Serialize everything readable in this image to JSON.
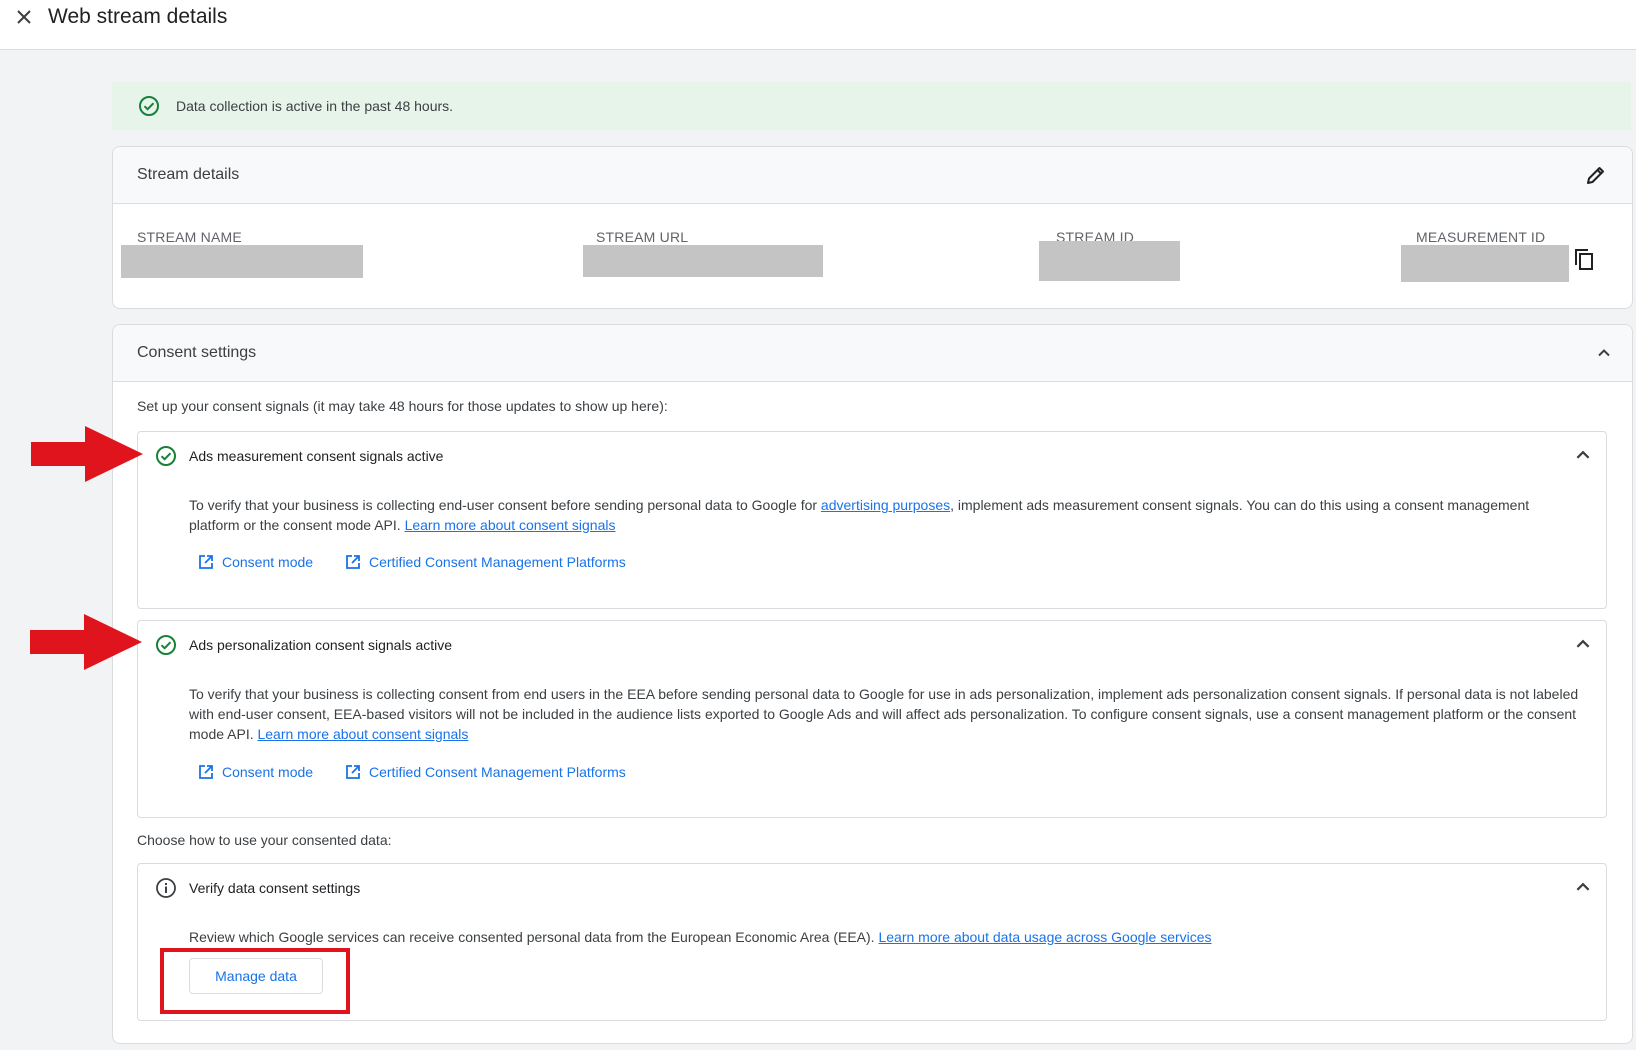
{
  "header": {
    "title": "Web stream details"
  },
  "banner": {
    "text": "Data collection is active in the past 48 hours."
  },
  "stream_details": {
    "title": "Stream details",
    "columns": [
      {
        "label": "STREAM NAME"
      },
      {
        "label": "STREAM URL"
      },
      {
        "label": "STREAM ID"
      },
      {
        "label": "MEASUREMENT ID"
      }
    ]
  },
  "consent": {
    "title": "Consent settings",
    "intro": "Set up your consent signals (it may take 48 hours for those updates to show up here):",
    "measurement": {
      "title": "Ads measurement consent signals active",
      "desc_1": "To verify that your business is collecting end-user consent before sending personal data to Google for ",
      "link_1": "advertising purposes",
      "desc_2": ", implement ads measurement consent signals. You can do this using a consent management platform or the consent mode API. ",
      "link_2": "Learn more about consent signals",
      "btn_1": "Consent mode",
      "btn_2": "Certified Consent Management Platforms"
    },
    "personalization": {
      "title": "Ads personalization consent signals active",
      "desc": "To verify that your business is collecting consent from end users in the EEA before sending personal data to Google for use in ads personalization, implement ads personalization consent signals. If personal data is not labeled with end-user consent, EEA-based visitors will not be included in the audience lists exported to Google Ads and will affect ads personalization. To configure consent signals, use a consent management platform or the consent mode API. ",
      "link": "Learn more about consent signals",
      "btn_1": "Consent mode",
      "btn_2": "Certified Consent Management Platforms"
    },
    "choose": "Choose how to use your consented data:",
    "verify": {
      "title": "Verify data consent settings",
      "desc": "Review which Google services can receive consented personal data from the European Economic Area (EEA). ",
      "link": "Learn more about data usage across Google services",
      "button": "Manage data"
    }
  },
  "colors": {
    "link": "#1a73e8",
    "success": "#188038",
    "annotation": "#e0141c",
    "banner_bg": "#e6f4ea"
  }
}
